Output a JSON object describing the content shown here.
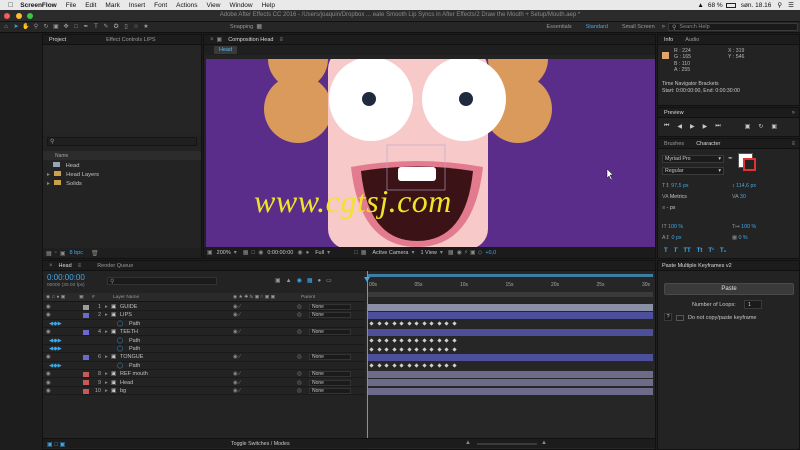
{
  "menubar": {
    "app": "ScreenFlow",
    "items": [
      "File",
      "Edit",
      "Mark",
      "Insert",
      "Font",
      "Actions",
      "View",
      "Window",
      "Help"
    ],
    "battery": "68 %",
    "clock": "søn. 18.16"
  },
  "window": {
    "title": "Adobe After Effects CC 2016 - /Users/joaquin/Dropbox ... eate Smooth Lip Syncs in After Effects/2 Draw the Mouth + Setup/Mouth.aep *"
  },
  "toolbar": {
    "snapping": "Snapping",
    "workspaces": [
      "Essentials",
      "Standard",
      "Small Screen"
    ],
    "active_workspace": "Standard",
    "search_placeholder": "Search Help"
  },
  "project": {
    "tabs": [
      "Project",
      "Effect Controls LIPS"
    ],
    "col_name": "Name",
    "items": [
      "Head",
      "Head Layers",
      "Solids"
    ],
    "bpc": "8 bpc"
  },
  "comp": {
    "tab": "Composition Head",
    "subtab": "Head",
    "zoom": "200%",
    "timecode": "0:00:00:00",
    "resolution": "Full",
    "camera": "Active Camera",
    "view": "1 View",
    "exposure": "+0,0",
    "watermark": "www.cgtsj.com"
  },
  "info": {
    "tabs": [
      "Info",
      "Audio"
    ],
    "r": "R : 224",
    "g": "G : 165",
    "b": "B : 110",
    "a": "A : 255",
    "x": "X : 319",
    "y": "Y : 546",
    "swatch": "#e0a56e",
    "nav_title": "Time Navigator Brackets",
    "nav_range": "Start: 0:00:00:00, End: 0:00:30:00"
  },
  "preview": {
    "tab": "Preview"
  },
  "character": {
    "tabs": [
      "Brushes",
      "Character"
    ],
    "font": "Myriad Pro",
    "style": "Regular",
    "size": "97,5 px",
    "leading": "114,6 px",
    "kerning": "Metrics",
    "tracking": "30",
    "stroke": "- px",
    "vscale": "100 %",
    "hscale": "100 %",
    "baseline": "0 px",
    "tsume": "0 %"
  },
  "keyframes": {
    "title": "Paste Multiple Keyframes v2",
    "paste": "Paste",
    "loops_label": "Number of Loops:",
    "loops_value": "1",
    "help": "?",
    "no_copy": "Do not copy/paste keyframe"
  },
  "timeline": {
    "tabs": [
      "Head",
      "Render Queue"
    ],
    "timecode": "0:00:00:00",
    "frames": "00000 (30.00 fps)",
    "col_layer": "Layer Name",
    "col_parent": "Parent",
    "toggle": "Toggle Switches / Modes",
    "ticks": [
      "00s",
      "05s",
      "10s",
      "15s",
      "20s",
      "25s",
      "30s"
    ],
    "layers": [
      {
        "num": "1",
        "name": "GUIDE",
        "parent": "None",
        "color": "#9c9c9c",
        "bar": "#8a8fa6",
        "kind": "layer"
      },
      {
        "num": "2",
        "name": "LIPS",
        "parent": "None",
        "color": "#6a6ad0",
        "bar": "#4e4f9b",
        "kind": "layer"
      },
      {
        "num": "",
        "name": "Path",
        "parent": "",
        "color": "",
        "bar": "",
        "kind": "prop"
      },
      {
        "num": "4",
        "name": "TEETH",
        "parent": "None",
        "color": "#6a6ad0",
        "bar": "#4e4f9b",
        "kind": "layer"
      },
      {
        "num": "",
        "name": "Path",
        "parent": "",
        "color": "",
        "bar": "",
        "kind": "prop"
      },
      {
        "num": "",
        "name": "Path",
        "parent": "",
        "color": "",
        "bar": "",
        "kind": "prop"
      },
      {
        "num": "6",
        "name": "TONGUE",
        "parent": "None",
        "color": "#6a6ad0",
        "bar": "#4e4f9b",
        "kind": "layer"
      },
      {
        "num": "",
        "name": "Path",
        "parent": "",
        "color": "",
        "bar": "",
        "kind": "prop"
      },
      {
        "num": "8",
        "name": "REF mouth",
        "parent": "None",
        "color": "#c65a5a",
        "bar": "#6c6c8a",
        "kind": "layer"
      },
      {
        "num": "9",
        "name": "Head",
        "parent": "None",
        "color": "#c65a5a",
        "bar": "#6c6c8a",
        "kind": "layer"
      },
      {
        "num": "10",
        "name": "bg",
        "parent": "None",
        "color": "#c65a5a",
        "bar": "#6c6c8a",
        "kind": "layer"
      }
    ]
  }
}
